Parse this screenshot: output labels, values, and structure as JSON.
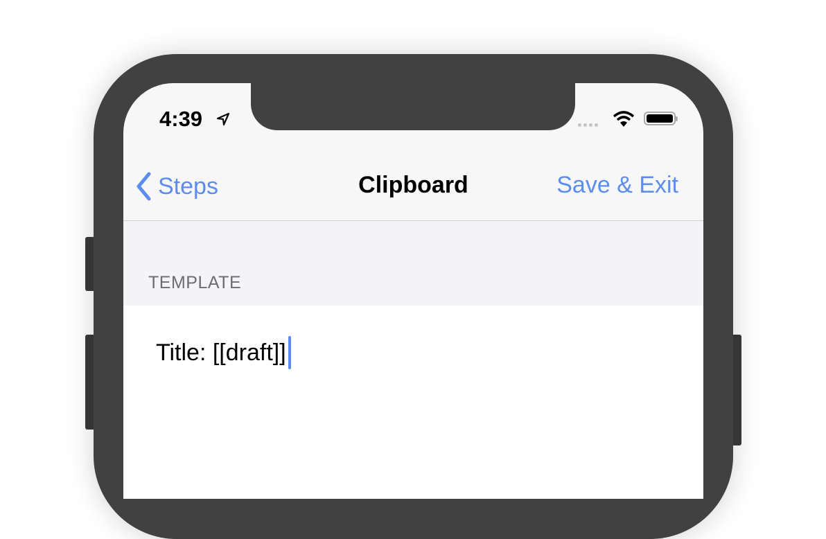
{
  "status_bar": {
    "time": "4:39",
    "icons": [
      "location-arrow-icon",
      "signal-dots-icon",
      "wifi-icon",
      "battery-icon"
    ]
  },
  "nav": {
    "back_label": "Steps",
    "title": "Clipboard",
    "action_label": "Save & Exit"
  },
  "section": {
    "label": "TEMPLATE"
  },
  "editor": {
    "value": "Title: [[draft]]"
  },
  "colors": {
    "accent": "#5b8def",
    "frame": "#414141"
  }
}
